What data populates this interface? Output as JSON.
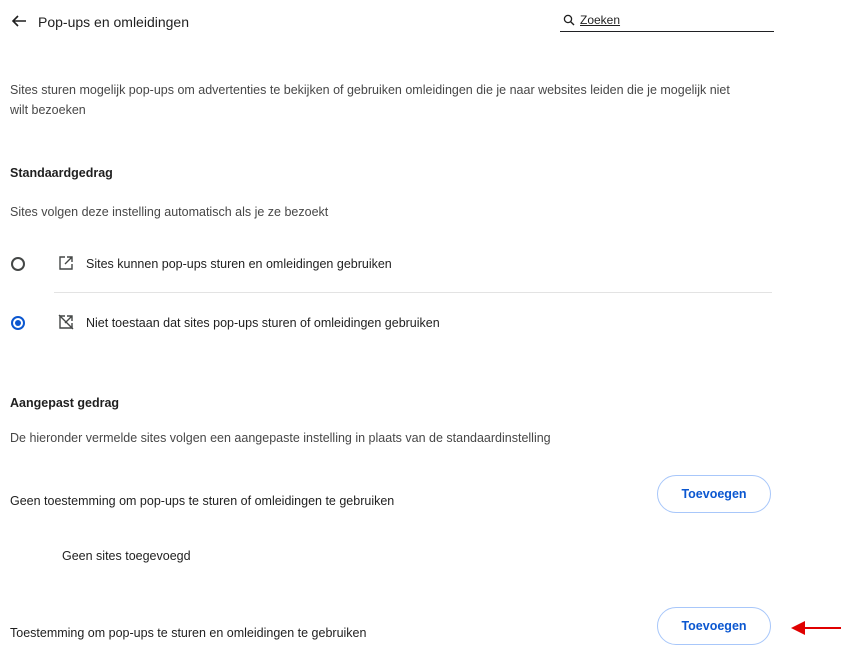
{
  "header": {
    "title": "Pop-ups en omleidingen",
    "search_placeholder": "Zoeken"
  },
  "description": "Sites sturen mogelijk pop-ups om advertenties te bekijken of gebruiken omleidingen die je naar websites leiden die je mogelijk niet wilt bezoeken",
  "default_behavior": {
    "heading": "Standaardgedrag",
    "subtitle": "Sites volgen deze instelling automatisch als je ze bezoekt",
    "options": [
      {
        "label": "Sites kunnen pop-ups sturen en omleidingen gebruiken",
        "selected": false,
        "icon": "open-in-new-icon"
      },
      {
        "label": "Niet toestaan dat sites pop-ups sturen of omleidingen gebruiken",
        "selected": true,
        "icon": "open-in-new-off-icon"
      }
    ]
  },
  "custom_behavior": {
    "heading": "Aangepast gedrag",
    "subtitle": "De hieronder vermelde sites volgen een aangepaste instelling in plaats van de standaardinstelling",
    "blocked": {
      "label": "Geen toestemming om pop-ups te sturen of omleidingen te gebruiken",
      "add_button": "Toevoegen",
      "empty_text": "Geen sites toegevoegd"
    },
    "allowed": {
      "label": "Toestemming om pop-ups te sturen en omleidingen te gebruiken",
      "add_button": "Toevoegen"
    }
  },
  "colors": {
    "accent": "#0b57d0",
    "annotation_arrow": "#e00000"
  }
}
